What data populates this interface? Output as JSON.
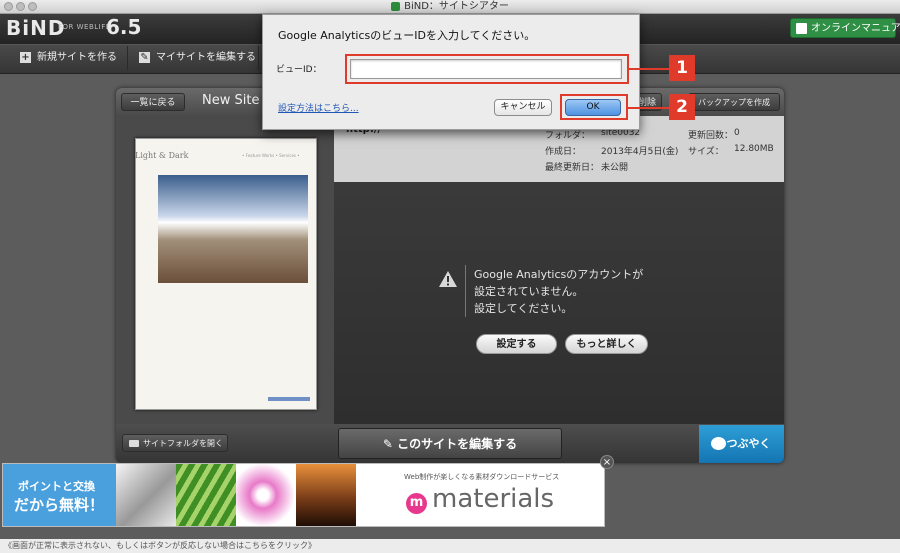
{
  "window": {
    "title": "BiND：サイトシアター"
  },
  "app": {
    "logo": "BiND",
    "logo_sub": "FOR WEBLIFE*",
    "version": "6.5",
    "manual_label": "オンラインマニュアル"
  },
  "toolbar": {
    "new_site_label": "新規サイトを作る",
    "edit_site_label": "マイサイトを編集する"
  },
  "panel": {
    "back_label": "一覧に戻る",
    "site_title": "New Site 3",
    "delete_label": "削除",
    "backup_label": "バックアップを作成"
  },
  "preview": {
    "thumb_title": "Light & Dark",
    "thumb_nav": "• Feature Works   • Services   • "
  },
  "info": {
    "url": "http://",
    "folder_label": "フォルダ：",
    "folder_value": "site0032",
    "created_label": "作成日：",
    "created_value": "2013年4月5日(金)",
    "updated_label": "最終更新日：",
    "updated_value": "未公開",
    "count_label": "更新回数：",
    "count_value": "0",
    "size_label": "サイズ：",
    "size_value": "12.80MB"
  },
  "notice": {
    "line1": "Google Analyticsのアカウントが",
    "line2": "設定されていません。",
    "line3": "設定してください。",
    "settings_label": "設定する",
    "details_label": "もっと詳しく"
  },
  "footer": {
    "folder_label": "サイトフォルダを開く",
    "edit_label": "このサイトを編集する",
    "tweet_label": "つぶやく"
  },
  "banner": {
    "line1": "ポイントと交換",
    "line2": "だから無料！",
    "caption": "Web制作が楽しくなる素材ダウンロードサービス",
    "brand": "materials",
    "brand_mark": "m"
  },
  "status": {
    "text": "《画面が正常に表示されない、もしくはボタンが反応しない場合はこちらをクリック》"
  },
  "dialog": {
    "title": "Google AnalyticsのビューIDを入力してください。",
    "view_id_label": "ビューID：",
    "view_id_value": "",
    "help_link": "設定方法はこちら...",
    "cancel_label": "キャンセル",
    "ok_label": "OK"
  },
  "callouts": {
    "one": "1",
    "two": "2"
  },
  "colors": {
    "accent_red": "#e03a2a",
    "manual_green": "#2f8f45",
    "tweet_blue": "#1e8ac7",
    "banner_blue": "#4aa0dc"
  },
  "icons": [
    "plus-icon",
    "pencil-icon",
    "book-icon",
    "warning-icon",
    "folder-icon",
    "edit-icon",
    "speech-bubble-icon",
    "close-icon"
  ]
}
